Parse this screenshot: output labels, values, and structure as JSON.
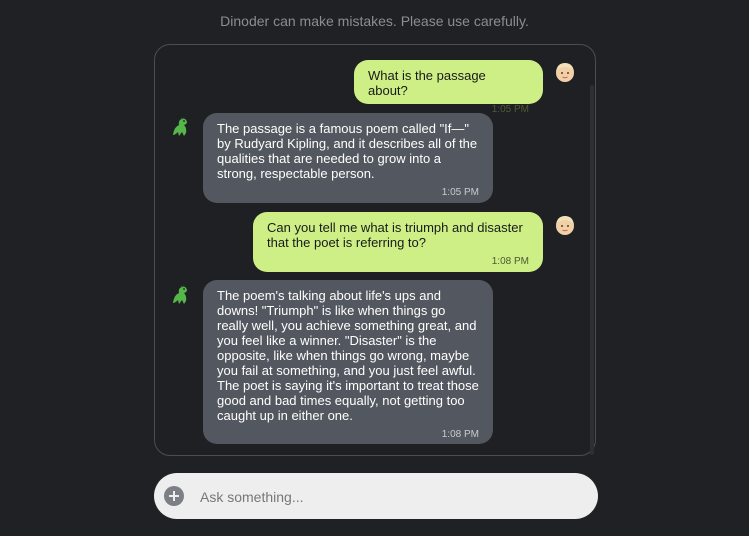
{
  "disclaimer": "Dinoder can make mistakes. Please use carefully.",
  "messages": [
    {
      "role": "user",
      "text": "What is the passage about?",
      "time": "1:05 PM",
      "avatar_icon": "person-light-skin-emoji"
    },
    {
      "role": "bot",
      "text": "The passage is a famous poem called \"If—\" by Rudyard Kipling, and it describes all of the qualities that are needed to grow into a strong, respectable person.",
      "time": "1:05 PM",
      "avatar_icon": "green-dinosaur-emoji"
    },
    {
      "role": "user",
      "text": "Can you tell me what is triumph and disaster that the poet is referring to?",
      "time": "1:08 PM",
      "avatar_icon": "person-light-skin-emoji"
    },
    {
      "role": "bot",
      "text": "The poem's talking about life's ups and downs! \"Triumph\" is like when things go really well, you achieve something great, and you feel like a winner. \"Disaster\" is the opposite, like when things go wrong, maybe you fail at something, and you just feel awful. The poet is saying it's important to treat those good and bad times equally, not getting too caught up in either one.",
      "time": "1:08 PM",
      "avatar_icon": "green-dinosaur-emoji"
    }
  ],
  "input": {
    "placeholder": "Ask something...",
    "value": ""
  },
  "colors": {
    "user_bubble": "#cdef85",
    "bot_bubble": "#53575f",
    "background": "#202124"
  }
}
